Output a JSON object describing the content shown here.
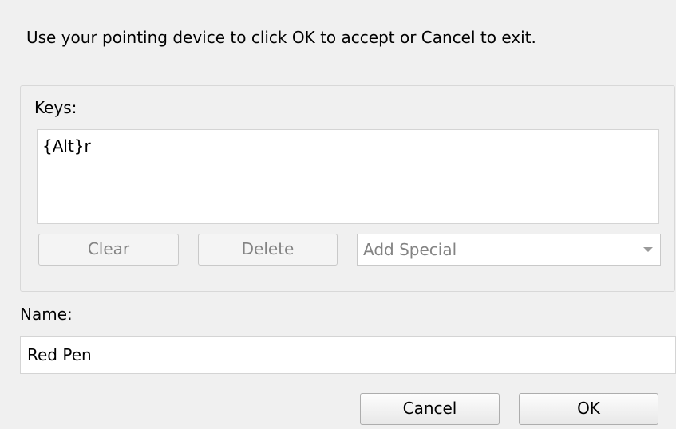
{
  "dialog": {
    "instruction": "Use your pointing device to click OK to accept or Cancel to exit."
  },
  "keys": {
    "label": "Keys:",
    "value": "{Alt}r",
    "clear_label": "Clear",
    "delete_label": "Delete",
    "add_special": {
      "selected": "Add Special",
      "enabled": false
    }
  },
  "name": {
    "label": "Name:",
    "value": "Red Pen"
  },
  "footer": {
    "cancel_label": "Cancel",
    "ok_label": "OK"
  },
  "icons": {
    "dropdown": "chevron-down-icon"
  },
  "colors": {
    "window_background": "#f0f0f0",
    "disabled_text": "#838383"
  }
}
